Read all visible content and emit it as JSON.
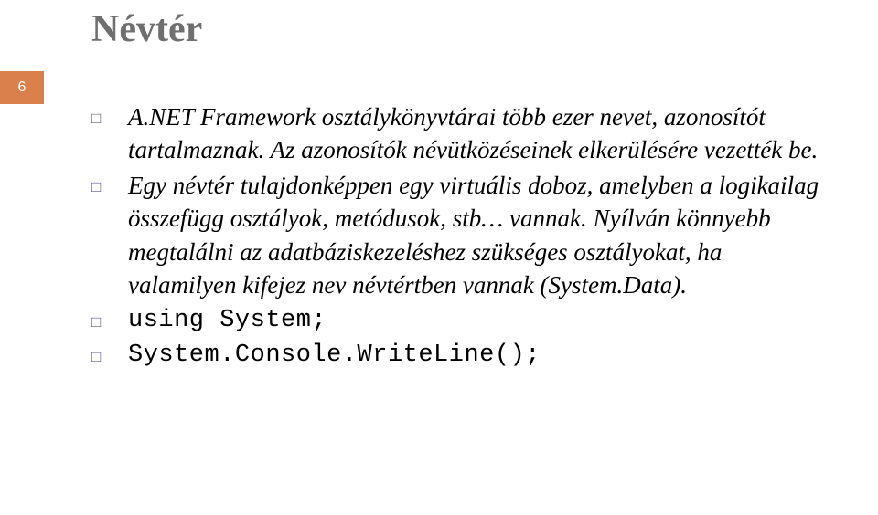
{
  "page_number": "6",
  "title": "Névtér",
  "bullets": [
    {
      "text": "A.NET Framework osztálykönyvtárai több ezer nevet, azonosítót tartalmaznak. Az azonosítók névütközéseinek elkerülésére vezették be.",
      "style": "italic"
    },
    {
      "text": "Egy névtér tulajdonképpen egy virtuális doboz, amelyben a logikailag összefügg osztályok, metódusok, stb… vannak. Nyílván könnyebb megtalálni az adatbáziskezeléshez szükséges osztályokat, ha valamilyen kifejez nev névtértben vannak (System.Data).",
      "style": "italic"
    },
    {
      "text": "using System;",
      "style": "code"
    },
    {
      "text": "System.Console.WriteLine();",
      "style": "code"
    }
  ]
}
